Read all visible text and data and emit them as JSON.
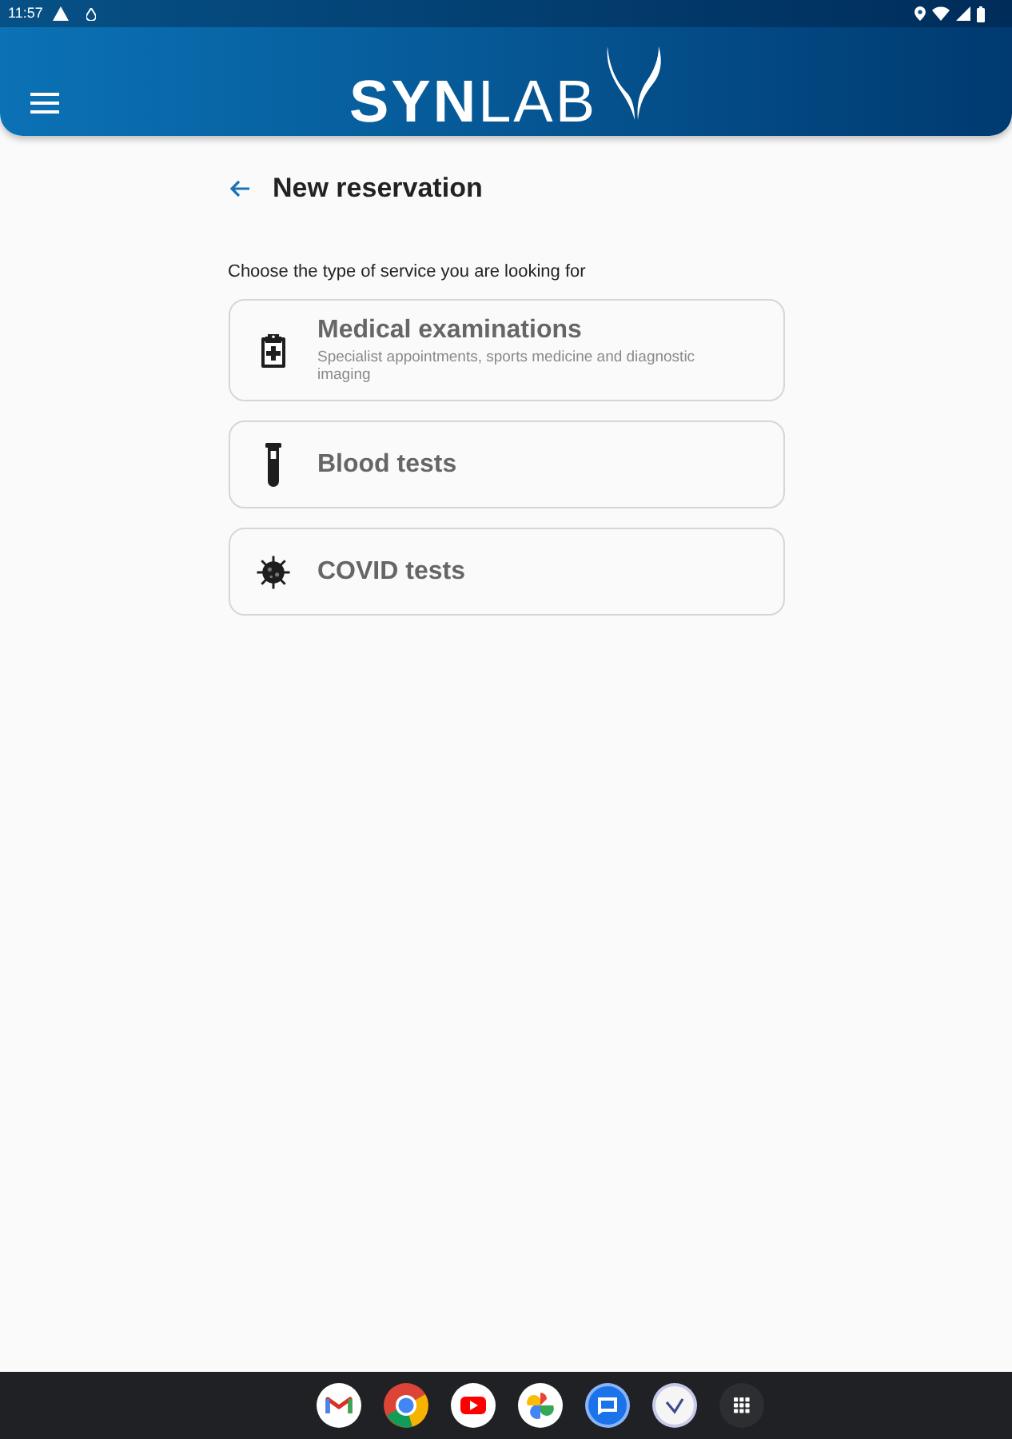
{
  "status_bar": {
    "time": "11:57"
  },
  "app_bar": {
    "logo": "**SYN**LAB"
  },
  "page": {
    "title": "New reservation",
    "prompt": "Choose the type of service you are looking for"
  },
  "services": [
    {
      "kind": "examination",
      "title": "Medical examinations",
      "description": "Specialist appointments, sports medicine and diagnostic imaging"
    },
    {
      "kind": "blood",
      "title": "Blood tests"
    },
    {
      "kind": "covid",
      "title": "COVID tests"
    }
  ]
}
